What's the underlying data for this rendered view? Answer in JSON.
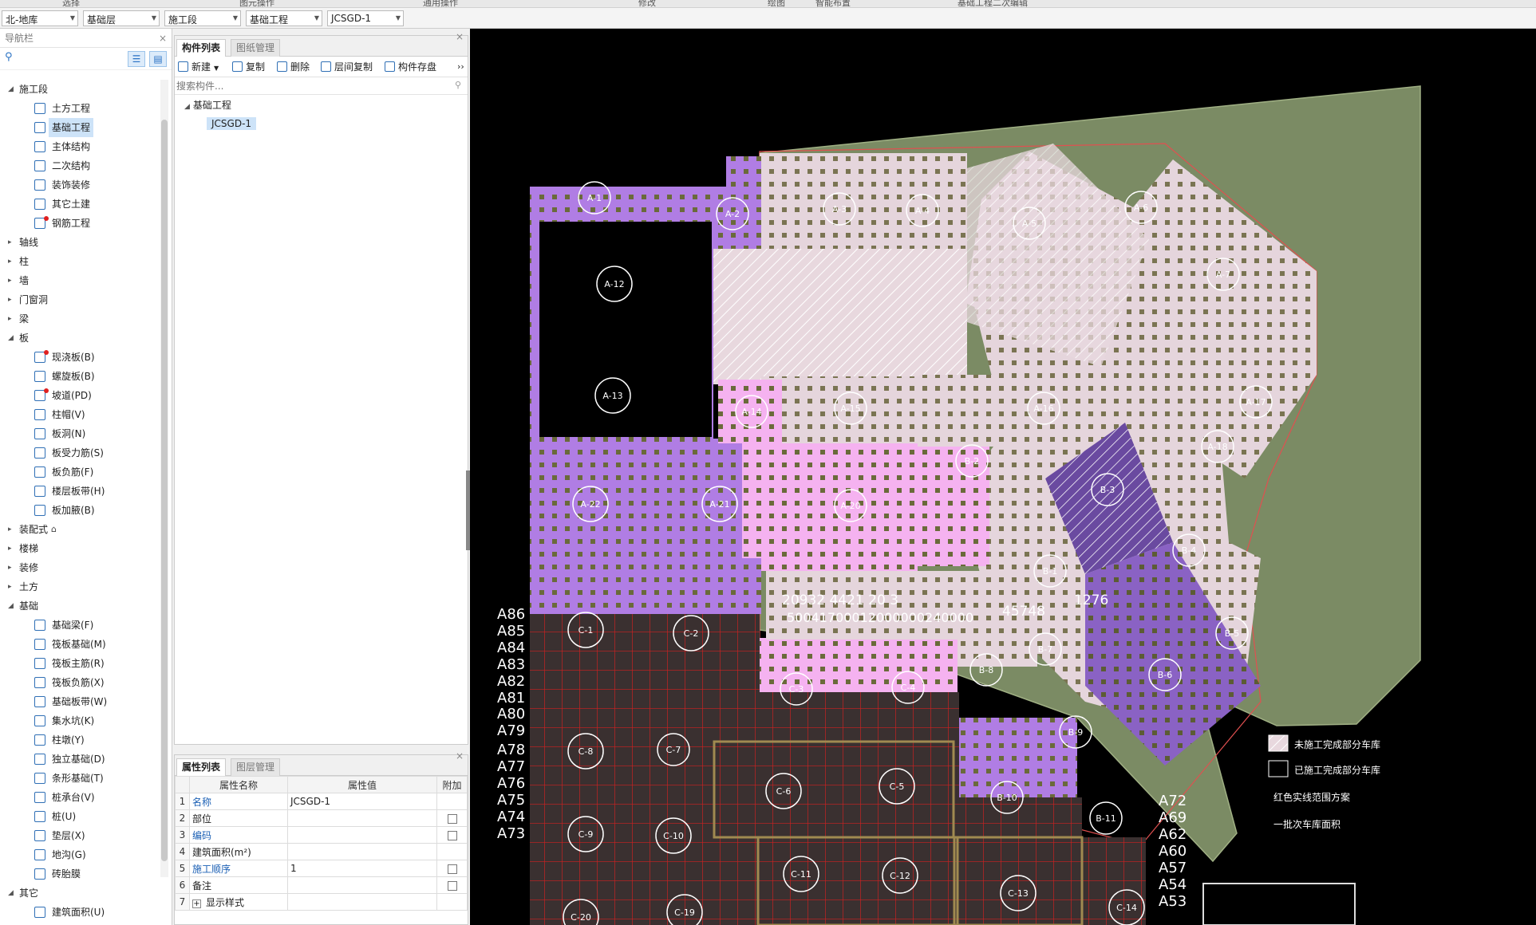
{
  "top_strip": [
    "选择",
    "图元操作",
    "通用操作",
    "修改",
    "绘图",
    "智能布置",
    "基础工程二次编辑"
  ],
  "selectors": {
    "floor_group": "北-地库",
    "floor": "基础层",
    "stage": "施工段",
    "engineering": "基础工程",
    "component": "JCSGD-1"
  },
  "nav": {
    "title": "导航栏",
    "close": "×",
    "tree": [
      {
        "label": "施工段",
        "level": 0,
        "expanded": true
      },
      {
        "label": "土方工程",
        "level": 1,
        "icon": "earthwork-icon"
      },
      {
        "label": "基础工程",
        "level": 1,
        "icon": "foundation-icon",
        "selected": true
      },
      {
        "label": "主体结构",
        "level": 1,
        "icon": "main-structure-icon"
      },
      {
        "label": "二次结构",
        "level": 1,
        "icon": "secondary-structure-icon"
      },
      {
        "label": "装饰装修",
        "level": 1,
        "icon": "decoration-icon"
      },
      {
        "label": "其它土建",
        "level": 1,
        "icon": "other-civil-icon"
      },
      {
        "label": "钢筋工程",
        "level": 1,
        "icon": "rebar-icon",
        "dot": true
      },
      {
        "label": "轴线",
        "level": 0
      },
      {
        "label": "柱",
        "level": 0
      },
      {
        "label": "墙",
        "level": 0
      },
      {
        "label": "门窗洞",
        "level": 0
      },
      {
        "label": "梁",
        "level": 0
      },
      {
        "label": "板",
        "level": 0,
        "expanded": true
      },
      {
        "label": "现浇板(B)",
        "level": 1,
        "icon": "cast-slab-icon",
        "dot": true
      },
      {
        "label": "螺旋板(B)",
        "level": 1,
        "icon": "spiral-slab-icon"
      },
      {
        "label": "坡道(PD)",
        "level": 1,
        "icon": "ramp-icon",
        "dot": true
      },
      {
        "label": "柱帽(V)",
        "level": 1,
        "icon": "column-cap-icon"
      },
      {
        "label": "板洞(N)",
        "level": 1,
        "icon": "slab-hole-icon"
      },
      {
        "label": "板受力筋(S)",
        "level": 1,
        "icon": "slab-main-rebar-icon"
      },
      {
        "label": "板负筋(F)",
        "level": 1,
        "icon": "slab-neg-rebar-icon"
      },
      {
        "label": "楼层板带(H)",
        "level": 1,
        "icon": "slab-strip-icon"
      },
      {
        "label": "板加腋(B)",
        "level": 1,
        "icon": "slab-haunch-icon"
      },
      {
        "label": "装配式",
        "level": 0,
        "lock": true
      },
      {
        "label": "楼梯",
        "level": 0
      },
      {
        "label": "装修",
        "level": 0
      },
      {
        "label": "土方",
        "level": 0
      },
      {
        "label": "基础",
        "level": 0,
        "expanded": true
      },
      {
        "label": "基础梁(F)",
        "level": 1,
        "icon": "foundation-beam-icon"
      },
      {
        "label": "筏板基础(M)",
        "level": 1,
        "icon": "raft-foundation-icon"
      },
      {
        "label": "筏板主筋(R)",
        "level": 1,
        "icon": "raft-main-rebar-icon"
      },
      {
        "label": "筏板负筋(X)",
        "level": 1,
        "icon": "raft-neg-rebar-icon"
      },
      {
        "label": "基础板带(W)",
        "level": 1,
        "icon": "foundation-strip-icon"
      },
      {
        "label": "集水坑(K)",
        "level": 1,
        "icon": "sump-pit-icon"
      },
      {
        "label": "柱墩(Y)",
        "level": 1,
        "icon": "column-pier-icon"
      },
      {
        "label": "独立基础(D)",
        "level": 1,
        "icon": "isolated-footing-icon"
      },
      {
        "label": "条形基础(T)",
        "level": 1,
        "icon": "strip-footing-icon"
      },
      {
        "label": "桩承台(V)",
        "level": 1,
        "icon": "pile-cap-icon"
      },
      {
        "label": "桩(U)",
        "level": 1,
        "icon": "pile-icon"
      },
      {
        "label": "垫层(X)",
        "level": 1,
        "icon": "cushion-icon"
      },
      {
        "label": "地沟(G)",
        "level": 1,
        "icon": "trench-icon"
      },
      {
        "label": "砖胎膜",
        "level": 1,
        "icon": "brick-mold-icon"
      },
      {
        "label": "其它",
        "level": 0,
        "expanded": true
      },
      {
        "label": "建筑面积(U)",
        "level": 1,
        "icon": "building-area-icon"
      }
    ]
  },
  "components": {
    "tabs": [
      "构件列表",
      "图纸管理"
    ],
    "toolbar": {
      "new": "新建",
      "copy": "复制",
      "delete": "删除",
      "floor_copy": "层间复制",
      "save": "构件存盘",
      "more": "››"
    },
    "search_placeholder": "搜索构件...",
    "tree_root": "基础工程",
    "tree_item": "JCSGD-1"
  },
  "props": {
    "tabs": [
      "属性列表",
      "图层管理"
    ],
    "headers": [
      "属性名称",
      "属性值",
      "附加"
    ],
    "rows": [
      {
        "no": "1",
        "name": "名称",
        "value": "JCSGD-1",
        "blue": true,
        "check": false
      },
      {
        "no": "2",
        "name": "部位",
        "value": "",
        "blue": false,
        "check": true
      },
      {
        "no": "3",
        "name": "编码",
        "value": "",
        "blue": true,
        "check": true
      },
      {
        "no": "4",
        "name": "建筑面积(m²)",
        "value": "",
        "blue": false,
        "check": false
      },
      {
        "no": "5",
        "name": "施工顺序",
        "value": "1",
        "blue": true,
        "check": true
      },
      {
        "no": "6",
        "name": "备注",
        "value": "",
        "blue": false,
        "check": true
      },
      {
        "no": "7",
        "name": "显示样式",
        "value": "",
        "blue": false,
        "check": false,
        "expand": true
      }
    ]
  },
  "cad": {
    "zones": [
      "A-1",
      "A-2",
      "A-3",
      "A-4",
      "A-5",
      "A-6",
      "A-7",
      "A-12",
      "A-13",
      "A-14",
      "A-15",
      "A-16",
      "A-17",
      "A-18",
      "A-20",
      "A-21",
      "A-22",
      "B-1",
      "B-2",
      "B-3",
      "B-4",
      "B-5",
      "B-6",
      "B-7",
      "B-8",
      "B-9",
      "B-10",
      "B-11",
      "C-1",
      "C-2",
      "C-3",
      "C-4",
      "C-5",
      "C-6",
      "C-7",
      "C-8",
      "C-9",
      "C-10",
      "C-11",
      "C-12",
      "C-13",
      "C-14",
      "C-19",
      "C-20"
    ],
    "axis_labels": [
      "A86",
      "A85",
      "A84",
      "A83",
      "A82",
      "A81",
      "A80",
      "A79",
      "A78",
      "A77",
      "A76",
      "A75",
      "A74",
      "A73",
      "A72",
      "A69",
      "A62",
      "A60",
      "A57",
      "A54",
      "A53"
    ],
    "dims_top": "20932  4421  20  3",
    "dims_bottom": "50041700012000000240000",
    "dim_45748": "45748",
    "dim_1276": "1276",
    "legend": {
      "unfinished": "未施工完成部分车库",
      "finished": "已施工完成部分车库",
      "red_line": "红色实线范围方案",
      "first_batch": "一批次车库面积"
    },
    "colors": {
      "purple": "#b27ee6",
      "pink": "#f7b8f2",
      "olive": "#7a8a5f",
      "light": "#e6d6dd",
      "dark": "#3a3030",
      "grid": "#d02020",
      "green_area": "#7a8a63"
    }
  }
}
